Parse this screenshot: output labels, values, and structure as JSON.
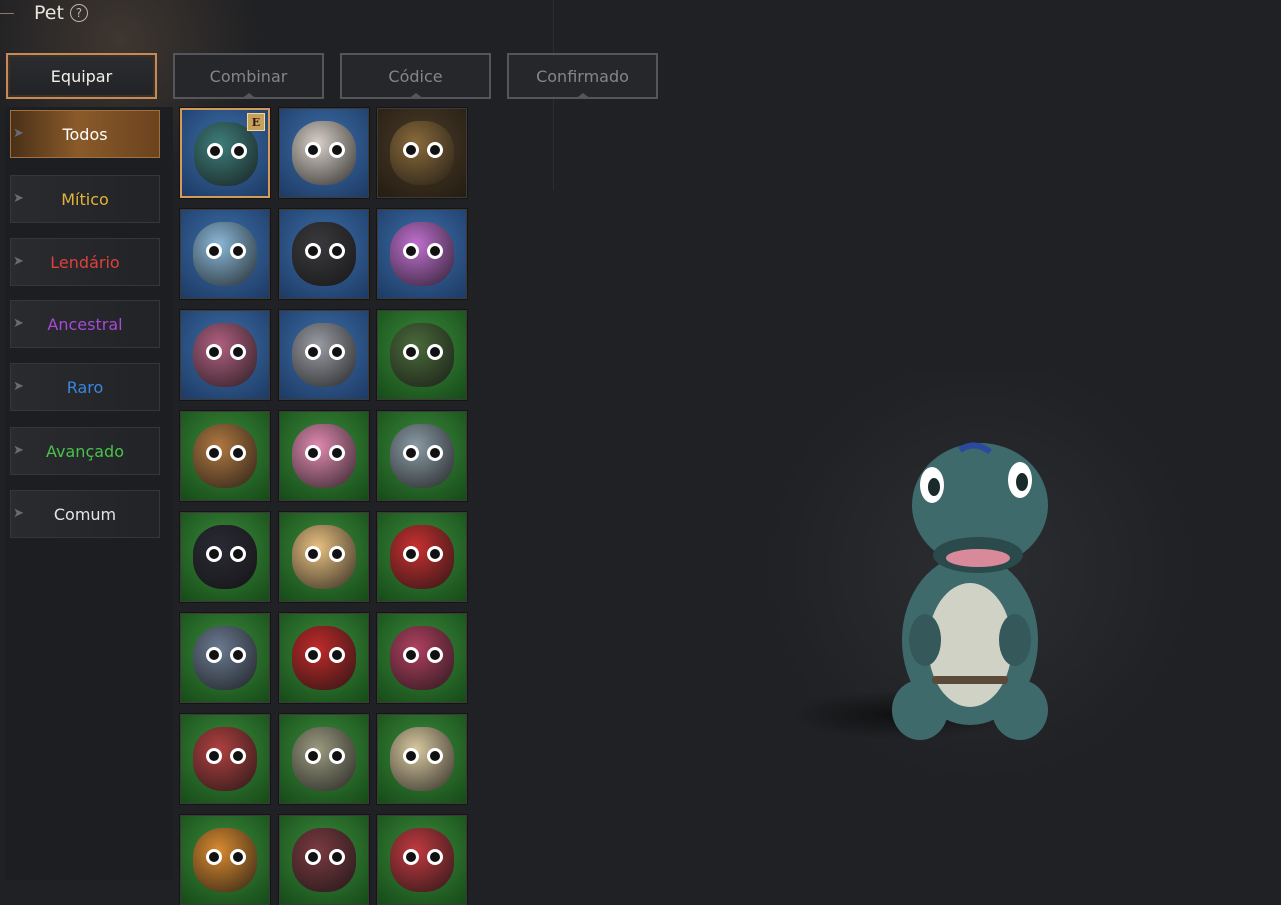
{
  "header": {
    "title": "Pet",
    "help_glyph": "?"
  },
  "tabs": [
    {
      "label": "Equipar",
      "active": true
    },
    {
      "label": "Combinar",
      "active": false
    },
    {
      "label": "Códice",
      "active": false
    },
    {
      "label": "Confirmado",
      "active": false
    }
  ],
  "filters": [
    {
      "label": "Todos",
      "color": "#ffffff",
      "active": true
    },
    {
      "label": "Mítico",
      "color": "#e2b43a",
      "active": false
    },
    {
      "label": "Lendário",
      "color": "#e0403a",
      "active": false
    },
    {
      "label": "Ancestral",
      "color": "#a64ad8",
      "active": false
    },
    {
      "label": "Raro",
      "color": "#3a86e0",
      "active": false
    },
    {
      "label": "Avançado",
      "color": "#4ac24a",
      "active": false
    },
    {
      "label": "Comum",
      "color": "#e4e4e4",
      "active": false
    }
  ],
  "pets": [
    {
      "bg": "blue",
      "body": "#3d7d7a",
      "icon": "dino-pet-icon",
      "equipped_badge": "E",
      "selected": true
    },
    {
      "bg": "blue",
      "body": "#d8d0c8",
      "icon": "twin-cats-pet-icon"
    },
    {
      "bg": "brown",
      "body": "#8a6a3a",
      "icon": "tree-golem-pet-icon"
    },
    {
      "bg": "blue",
      "body": "#8ab8d8",
      "icon": "ice-golem-pet-icon"
    },
    {
      "bg": "blue",
      "body": "#3a3a3e",
      "icon": "black-cats-pet-icon"
    },
    {
      "bg": "blue",
      "body": "#c070d0",
      "icon": "unicorn-pet-icon"
    },
    {
      "bg": "blue",
      "body": "#b06080",
      "icon": "robot-pet-icon"
    },
    {
      "bg": "blue",
      "body": "#9a9ca4",
      "icon": "gray-cat-pet-icon"
    },
    {
      "bg": "green",
      "body": "#4a6a3a",
      "icon": "green-lizard-pet-icon"
    },
    {
      "bg": "green",
      "body": "#b07840",
      "icon": "brown-sprout-pet-icon"
    },
    {
      "bg": "green",
      "body": "#e08ab0",
      "icon": "pink-fairy-pet-icon"
    },
    {
      "bg": "green",
      "body": "#8a9aa4",
      "icon": "gray-lizard-pet-icon"
    },
    {
      "bg": "green",
      "body": "#2a2a34",
      "icon": "toucan-pet-icon"
    },
    {
      "bg": "green",
      "body": "#e8c080",
      "icon": "blonde-fairy-pet-icon"
    },
    {
      "bg": "green",
      "body": "#c83030",
      "icon": "red-parrot-pet-icon"
    },
    {
      "bg": "green",
      "body": "#6a7a90",
      "icon": "gray-sprout-pet-icon"
    },
    {
      "bg": "green",
      "body": "#c02a2a",
      "icon": "red-lizard-pet-icon"
    },
    {
      "bg": "green",
      "body": "#b04060",
      "icon": "pink-sprout-pet-icon"
    },
    {
      "bg": "green",
      "body": "#b04040",
      "icon": "red-owl-pet-icon"
    },
    {
      "bg": "green",
      "body": "#9a9a80",
      "icon": "beige-sprout-pet-icon"
    },
    {
      "bg": "green",
      "body": "#d8c8a0",
      "icon": "eagle-pet-icon"
    },
    {
      "bg": "green",
      "body": "#d88a30",
      "icon": "orange-sprout-pet-icon"
    },
    {
      "bg": "green",
      "body": "#7a3a40",
      "icon": "dark-lizard-pet-icon"
    },
    {
      "bg": "green",
      "body": "#c03a40",
      "icon": "red-fairy-pet-icon"
    }
  ],
  "preview": {
    "name": "dino-pet-model",
    "body_color": "#3f6a6c",
    "belly_color": "#cfd2c4",
    "mouth_color": "#d98a9a"
  }
}
